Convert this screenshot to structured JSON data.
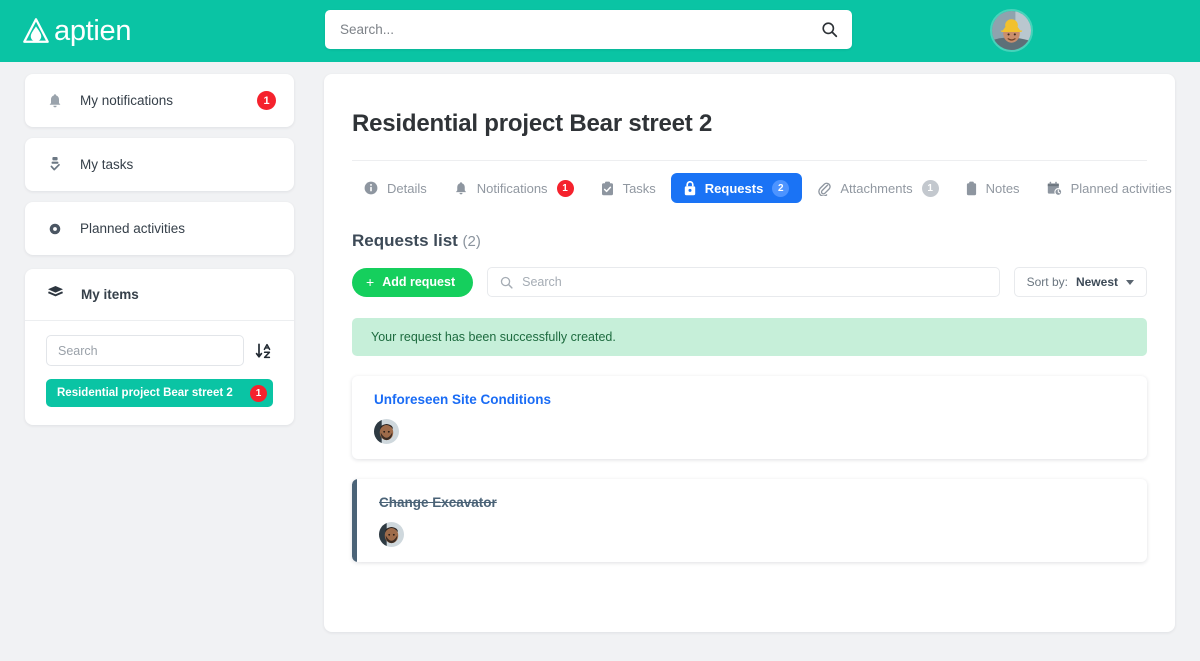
{
  "topbar": {
    "brand": "aptien",
    "logo_icon": "aptien-droplet-logo",
    "search": {
      "placeholder": "Search...",
      "value": "",
      "icon": "search-icon"
    },
    "avatar_icon": "user-avatar-hardhat"
  },
  "sidebar": {
    "nav": [
      {
        "label": "My notifications",
        "icon": "bell-icon",
        "badge": "1"
      },
      {
        "label": "My tasks",
        "icon": "task-check-icon",
        "badge": ""
      },
      {
        "label": "Planned activities",
        "icon": "dot-circle-icon",
        "badge": ""
      }
    ],
    "my_items": {
      "title": "My items",
      "icon": "layers-icon",
      "search_placeholder": "Search",
      "search_value": "",
      "sort_icon": "sort-az-icon",
      "item": {
        "label": "Residential project Bear street 2",
        "badge": "1"
      }
    }
  },
  "main": {
    "page_title": "Residential project Bear street 2",
    "tabs": [
      {
        "label": "Details",
        "icon": "info-icon",
        "badge": "",
        "badge_color": "",
        "active": false
      },
      {
        "label": "Notifications",
        "icon": "bell-icon",
        "badge": "1",
        "badge_color": "red",
        "active": false
      },
      {
        "label": "Tasks",
        "icon": "clipboard-check-icon",
        "badge": "",
        "badge_color": "",
        "active": false
      },
      {
        "label": "Requests",
        "icon": "request-lock-icon",
        "badge": "2",
        "badge_color": "blue",
        "active": true
      },
      {
        "label": "Attachments",
        "icon": "paperclip-icon",
        "badge": "1",
        "badge_color": "gray",
        "active": false
      },
      {
        "label": "Notes",
        "icon": "note-icon",
        "badge": "",
        "badge_color": "",
        "active": false
      },
      {
        "label": "Planned activities",
        "icon": "calendar-clock-icon",
        "badge": "",
        "badge_color": "",
        "active": false
      }
    ],
    "section": {
      "title": "Requests list",
      "count": "(2)"
    },
    "toolbar": {
      "add_label": "Add request",
      "add_icon": "plus-icon",
      "search_placeholder": "Search",
      "search_value": "",
      "search_icon": "search-icon",
      "sort_label": "Sort by:",
      "sort_value": "Newest",
      "sort_caret_icon": "chevron-down-icon"
    },
    "alert": {
      "text": "Your request has been successfully created."
    },
    "requests": [
      {
        "title": "Unforeseen Site Conditions",
        "closed": false,
        "avatar_icon": "user-avatar-bearded"
      },
      {
        "title": "Change Excavator",
        "closed": true,
        "avatar_icon": "user-avatar-bearded"
      }
    ]
  },
  "colors": {
    "brand_teal": "#0ac4a4",
    "accent_blue": "#1a73f5",
    "badge_red": "#f5222d",
    "add_green": "#15cf5d",
    "alert_green_bg": "#c6efd9",
    "closed_bar": "#4b6377"
  }
}
